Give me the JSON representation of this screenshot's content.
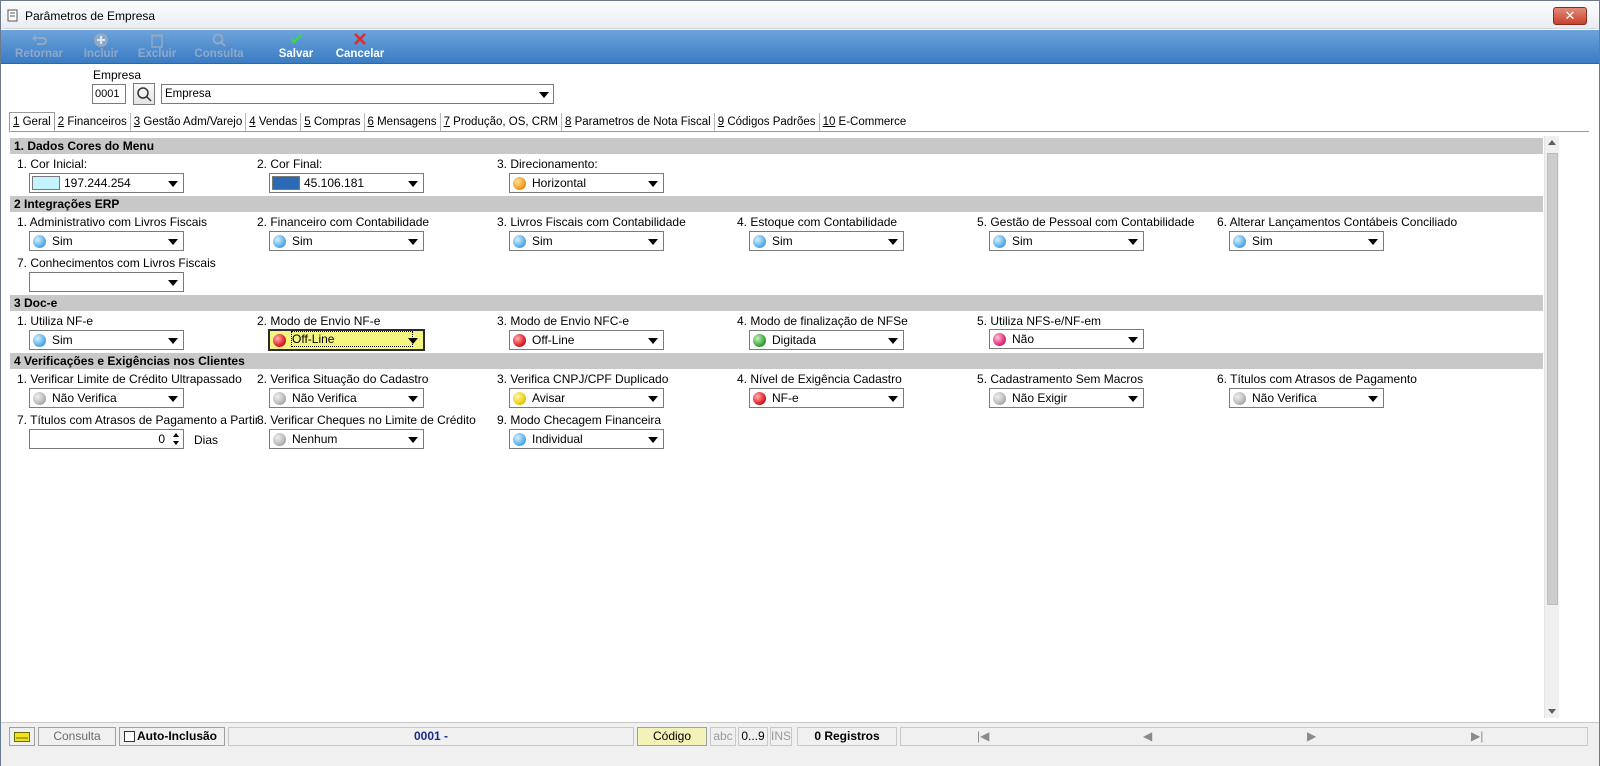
{
  "window": {
    "title": "Parâmetros de Empresa",
    "close_label": "✕"
  },
  "toolbar": {
    "buttons": [
      {
        "label": "Retornar",
        "enabled": false
      },
      {
        "label": "Incluir",
        "enabled": false
      },
      {
        "label": "Excluir",
        "enabled": false
      },
      {
        "label": "Consulta",
        "enabled": false
      },
      {
        "label": "Salvar",
        "enabled": true
      },
      {
        "label": "Cancelar",
        "enabled": true
      }
    ]
  },
  "empresa": {
    "label": "Empresa",
    "code": "0001",
    "name": "Empresa"
  },
  "tabs": [
    {
      "num": "1",
      "label": " Geral"
    },
    {
      "num": "2",
      "label": " Financeiros"
    },
    {
      "num": "3",
      "label": " Gestão Adm/Varejo"
    },
    {
      "num": "4",
      "label": " Vendas"
    },
    {
      "num": "5",
      "label": " Compras"
    },
    {
      "num": "6",
      "label": " Mensagens"
    },
    {
      "num": "7",
      "label": " Produção, OS, CRM"
    },
    {
      "num": "8",
      "label": " Parametros de Nota Fiscal"
    },
    {
      "num": "9",
      "label": " Códigos Padrões"
    },
    {
      "num": "10",
      "label": " E-Commerce"
    }
  ],
  "sections": {
    "s1": {
      "title": "1.  Dados Cores do Menu",
      "fields": [
        {
          "label": "1. Cor Inicial:",
          "value": "197.244.254",
          "color": "#c5f4fe"
        },
        {
          "label": "2. Cor Final:",
          "value": "45.106.181",
          "color": "#2d6ab5"
        },
        {
          "label": "3. Direcionamento:",
          "value": "Horizontal",
          "color": "#f0a020"
        }
      ]
    },
    "s2": {
      "title": "2 Integrações ERP",
      "fields": [
        {
          "label": "1. Administrativo com Livros Fiscais",
          "value": "Sim",
          "color": "#5ab0ea"
        },
        {
          "label": "2. Financeiro com Contabilidade",
          "value": "Sim",
          "color": "#5ab0ea"
        },
        {
          "label": "3. Livros Fiscais com Contabilidade",
          "value": "Sim",
          "color": "#5ab0ea"
        },
        {
          "label": "4. Estoque com Contabilidade",
          "value": "Sim",
          "color": "#5ab0ea"
        },
        {
          "label": "5. Gestão de Pessoal com Contabilidade",
          "value": "Sim",
          "color": "#5ab0ea"
        },
        {
          "label": "6. Alterar Lançamentos Contábeis Conciliado",
          "value": "Sim",
          "color": "#5ab0ea"
        },
        {
          "label": "7. Conhecimentos com Livros Fiscais",
          "value": "",
          "color": ""
        }
      ]
    },
    "s3": {
      "title": "3  Doc-e",
      "fields": [
        {
          "label": "1. Utiliza NF-e",
          "value": "Sim",
          "color": "#5ab0ea"
        },
        {
          "label": "2. Modo de Envio NF-e",
          "value": "Off-Line",
          "color": "#e0202a"
        },
        {
          "label": "3. Modo de Envio NFC-e",
          "value": "Off-Line",
          "color": "#e0202a"
        },
        {
          "label": "4. Modo de finalização de NFSe",
          "value": "Digitada",
          "color": "#3aa83a"
        },
        {
          "label": "5. Utiliza NFS-e/NF-em",
          "value": "Não",
          "color": "#e0307a"
        }
      ]
    },
    "s4": {
      "title": "4 Verificações e Exigências nos Clientes",
      "fields": [
        {
          "label": "1. Verificar Limite de Crédito Ultrapassado",
          "value": "Não Verifica",
          "color": "#b8b8b8"
        },
        {
          "label": "2. Verifica Situação do Cadastro",
          "value": "Não Verifica",
          "color": "#b8b8b8"
        },
        {
          "label": "3. Verifica CNPJ/CPF Duplicado",
          "value": "Avisar",
          "color": "#f0d010"
        },
        {
          "label": "4. Nível de Exigência Cadastro",
          "value": "NF-e",
          "color": "#e0202a"
        },
        {
          "label": "5. Cadastramento Sem Macros",
          "value": "Não Exigir",
          "color": "#b8b8b8"
        },
        {
          "label": "6. Títulos com Atrasos de Pagamento",
          "value": "Não Verifica",
          "color": "#b8b8b8"
        },
        {
          "label": "7. Títulos com Atrasos de Pagamento a Partir",
          "value": "0",
          "unit": "Dias"
        },
        {
          "label": "8. Verificar Cheques no Limite de Crédito",
          "value": "Nenhum",
          "color": "#b8b8b8"
        },
        {
          "label": "9. Modo Checagem Financeira",
          "value": "Individual",
          "color": "#5ab0ea"
        }
      ]
    }
  },
  "statusbar": {
    "mode": "Consulta",
    "auto_inclusao": "Auto-Inclusão",
    "record": "0001 -",
    "sort_field": "Código",
    "abc": "abc",
    "range": "0...9",
    "ins": "INS",
    "registros": "0 Registros",
    "nav_first": "|◀",
    "nav_prev": "◀",
    "nav_next": "▶",
    "nav_last": "▶|"
  }
}
